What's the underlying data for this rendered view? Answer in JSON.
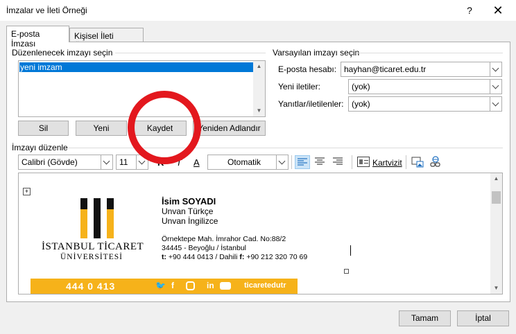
{
  "window": {
    "title": "İmzalar ve İleti Örneği",
    "help": "?",
    "close": "✕"
  },
  "tabs": [
    {
      "label": "E-posta İmzası",
      "active": true
    },
    {
      "label": "Kişisel İleti Örneği",
      "active": false
    }
  ],
  "select_section": {
    "legend": "Düzenlenecek imzayı seçin",
    "items": [
      "yeni imzam"
    ],
    "selected": "yeni imzam",
    "buttons": {
      "delete": "Sil",
      "new": "Yeni",
      "save": "Kaydet",
      "rename": "Yeniden Adlandır"
    }
  },
  "defaults_section": {
    "legend": "Varsayılan imzayı seçin",
    "email_label": "E-posta hesabı:",
    "email_value": "hayhan@ticaret.edu.tr",
    "new_label": "Yeni iletiler:",
    "new_value": "(yok)",
    "reply_label": "Yanıtlar/iletilenler:",
    "reply_value": "(yok)"
  },
  "editor_section": {
    "legend": "İmzayı düzenle",
    "toolbar": {
      "font": "Calibri (Gövde)",
      "size": "11",
      "bold": "K",
      "italic": "T",
      "underline": "A",
      "color": "Otomatik",
      "business_card": "Kartvizit"
    },
    "signature": {
      "logo_line1": "İSTANBUL TİCARET",
      "logo_line2": "ÜNİVERSİTESİ",
      "name": "İsim SOYADI",
      "title_tr": "Unvan Türkçe",
      "title_en": "Unvan İngilizce",
      "address1": "Örnektepe Mah. İmrahor Cad. No:88/2",
      "address2": "34445 - Beyoğlu / İstanbul",
      "phone_prefix": "t:",
      "phone": "+90 444 0413 / Dahili",
      "fax_prefix": "f:",
      "fax": "+90 212 320 70 69",
      "banner_phone": "444 0 413",
      "banner_social": "ticaretedutr"
    }
  },
  "footer": {
    "ok": "Tamam",
    "cancel": "İptal"
  },
  "colors": {
    "accent": "#0078d7",
    "banner": "#f6b21a",
    "highlight_circle": "#e3181e"
  }
}
